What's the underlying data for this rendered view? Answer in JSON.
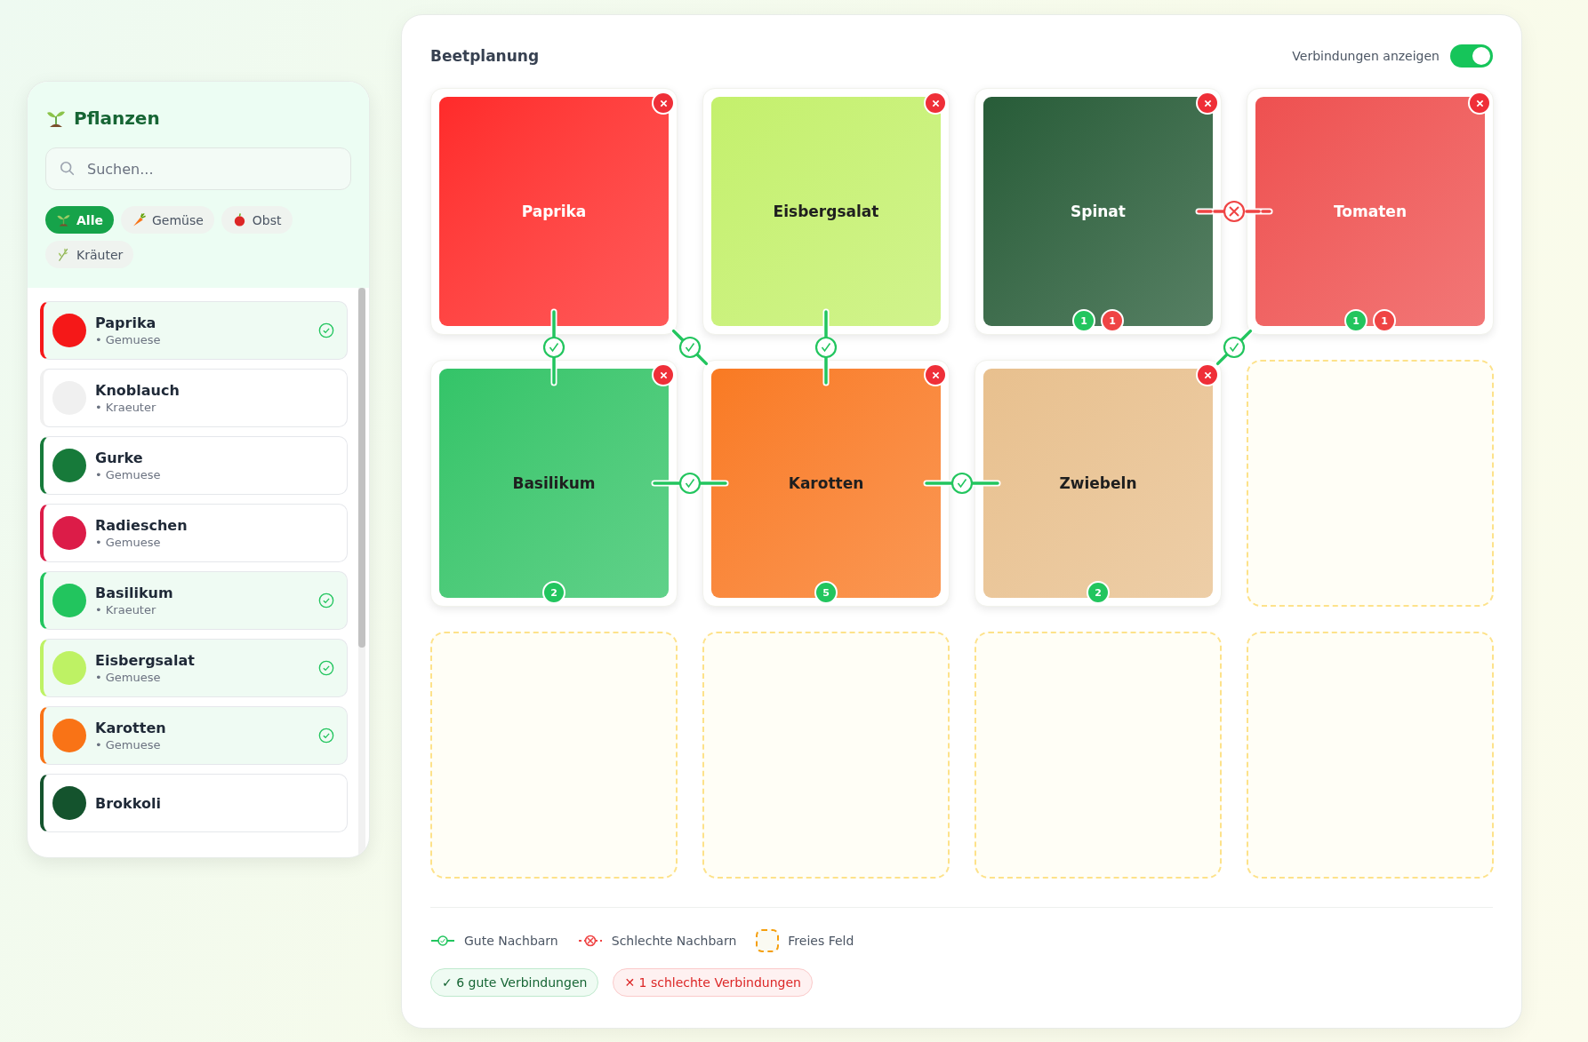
{
  "sidebar": {
    "title": "Pflanzen",
    "search": {
      "placeholder": "Suchen..."
    },
    "filters": [
      {
        "label": "Alle",
        "kind": "sprout",
        "selected": true
      },
      {
        "label": "Gemüse",
        "kind": "carrot",
        "selected": false
      },
      {
        "label": "Obst",
        "kind": "apple",
        "selected": false
      },
      {
        "label": "Kräuter",
        "kind": "herb",
        "selected": false
      }
    ],
    "plants": [
      {
        "name": "Paprika",
        "category": "• Gemuese",
        "color": "#f51818",
        "placed": true
      },
      {
        "name": "Knoblauch",
        "category": "• Kraeuter",
        "color": "#f0f0f0",
        "placed": false
      },
      {
        "name": "Gurke",
        "category": "• Gemuese",
        "color": "#177a3a",
        "placed": false
      },
      {
        "name": "Radieschen",
        "category": "• Gemuese",
        "color": "#dc1c48",
        "placed": false
      },
      {
        "name": "Basilikum",
        "category": "• Kraeuter",
        "color": "#22c55e",
        "placed": true
      },
      {
        "name": "Eisbergsalat",
        "category": "• Gemuese",
        "color": "#bef264",
        "placed": true
      },
      {
        "name": "Karotten",
        "category": "• Gemuese",
        "color": "#f97316",
        "placed": true
      },
      {
        "name": "Brokkoli",
        "color": "#14532d",
        "placed": false
      }
    ]
  },
  "bed": {
    "title": "Beetplanung",
    "toggle": {
      "label": "Verbindungen anzeigen",
      "on": true
    },
    "cells": [
      {
        "kind": "plant",
        "plant": "Paprika",
        "color": "#ff2a2a",
        "links": {
          "good_down": true,
          "good_down_right": true
        }
      },
      {
        "kind": "plant",
        "plant": "Eisbergsalat",
        "color": "#c4f06c",
        "links": {
          "good_down": true
        }
      },
      {
        "kind": "plant",
        "plant": "Spinat",
        "color": "#275c38",
        "badges": [
          {
            "kind": "good",
            "count": "1"
          },
          {
            "kind": "bad",
            "count": "1"
          }
        ],
        "links": {
          "bad_right": true
        }
      },
      {
        "kind": "plant",
        "plant": "Tomaten",
        "color": "#ee5050",
        "badges": [
          {
            "kind": "good",
            "count": "1"
          },
          {
            "kind": "bad",
            "count": "1"
          }
        ],
        "links": {
          "good_down_left": true
        }
      },
      {
        "kind": "plant",
        "plant": "Basilikum",
        "color": "#33c468",
        "badges": [
          {
            "kind": "good",
            "count": "2"
          }
        ],
        "links": {
          "good_right": true
        }
      },
      {
        "kind": "plant",
        "plant": "Karotten",
        "color": "#f97a22",
        "badges": [
          {
            "kind": "good",
            "count": "5"
          }
        ],
        "links": {
          "good_right": true
        }
      },
      {
        "kind": "plant",
        "plant": "Zwiebeln",
        "color": "#e8c08e",
        "badges": [
          {
            "kind": "good",
            "count": "2"
          }
        ]
      },
      {
        "kind": "empty"
      },
      {
        "kind": "empty"
      },
      {
        "kind": "empty"
      },
      {
        "kind": "empty"
      },
      {
        "kind": "empty"
      }
    ],
    "legend": [
      {
        "kind": "good",
        "label": "Gute Nachbarn"
      },
      {
        "kind": "bad",
        "label": "Schlechte Nachbarn"
      },
      {
        "kind": "free",
        "label": "Freies Feld"
      }
    ],
    "summary": [
      {
        "kind": "good",
        "text": "✓ 6 gute Verbindungen"
      },
      {
        "kind": "bad",
        "text": "✕ 1 schlechte Verbindungen"
      }
    ]
  }
}
